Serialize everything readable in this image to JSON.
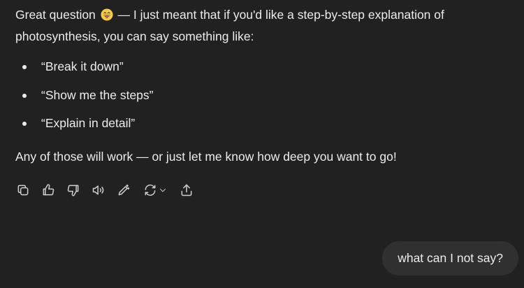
{
  "assistant": {
    "intro_before_emoji": "Great question",
    "emoji_icon": "grinning-face-emoji",
    "intro_after_emoji": " — I just meant that if you'd like a step-by-step explanation of photosynthesis, you can say something like:",
    "suggestions": [
      "“Break it down”",
      "“Show me the steps”",
      "“Explain in detail”"
    ],
    "closing": "Any of those will work — or just let me know how deep you want to go!"
  },
  "toolbar": {
    "icons": [
      "copy-icon",
      "thumbs-up-icon",
      "thumbs-down-icon",
      "read-aloud-icon",
      "edit-icon",
      "regenerate-icon",
      "chevron-down-icon",
      "share-icon"
    ]
  },
  "user": {
    "message": "what can I not say?"
  },
  "colors": {
    "background": "#212121",
    "text": "#ececec",
    "user_bubble": "#303030",
    "icon": "#cfcfcf"
  }
}
